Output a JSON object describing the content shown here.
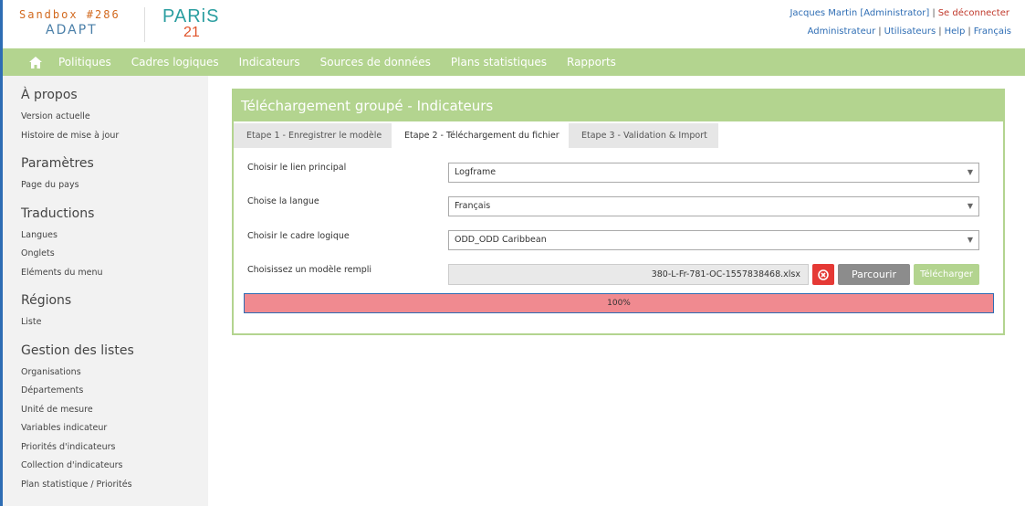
{
  "header": {
    "sandbox": "Sandbox #286",
    "adapt": "ADAPT",
    "logo_paris": "PARiS",
    "logo_21": "21",
    "user": "Jacques Martin [Administrator]",
    "logout": "Se déconnecter",
    "links": [
      "Administrateur",
      "Utilisateurs",
      "Help",
      "Français"
    ]
  },
  "nav": {
    "home_icon": "home-icon",
    "items": [
      "Politiques",
      "Cadres logiques",
      "Indicateurs",
      "Sources de données",
      "Plans statistiques",
      "Rapports"
    ]
  },
  "sidebar": {
    "sections": [
      {
        "title": "À propos",
        "links": [
          "Version actuelle",
          "Histoire de mise à jour"
        ]
      },
      {
        "title": "Paramètres",
        "links": [
          "Page du pays"
        ]
      },
      {
        "title": "Traductions",
        "links": [
          "Langues",
          "Onglets",
          "Eléments du menu"
        ]
      },
      {
        "title": "Régions",
        "links": [
          "Liste"
        ]
      },
      {
        "title": "Gestion des listes",
        "links": [
          "Organisations",
          "Départements",
          "Unité de mesure",
          "Variables indicateur",
          "Priorités d'indicateurs",
          "Collection d'indicateurs",
          "Plan statistique / Priorités"
        ]
      }
    ]
  },
  "panel": {
    "title": "Téléchargement groupé - Indicateurs",
    "tabs": [
      "Etape  1 - Enregistrer le modèle",
      "Etape  2 - Téléchargement du fichier",
      "Etape  3 - Validation & Import"
    ],
    "active_tab": 1,
    "fields": {
      "main_link_label": "Choisir le lien principal",
      "main_link_value": "Logframe",
      "language_label": "Choise la langue",
      "language_value": "Français",
      "logframe_label": "Choisir le cadre logique",
      "logframe_value": "ODD_ODD Caribbean",
      "template_label": "Choisissez un modèle rempli",
      "template_file": "380-L-Fr-781-OC-1557838468.xlsx"
    },
    "buttons": {
      "browse": "Parcourir",
      "upload": "Télécharger"
    },
    "progress": {
      "label": "100%",
      "value": 1.0
    }
  },
  "colors": {
    "accent_green": "#b3d48f",
    "link_blue": "#2e6db4",
    "progress_fill": "#f08a90",
    "danger": "#e53935"
  }
}
